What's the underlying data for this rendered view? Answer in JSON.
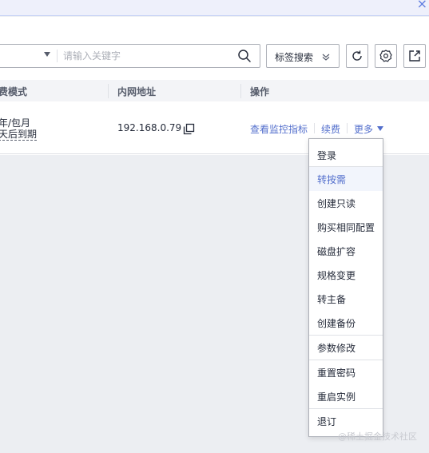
{
  "banner": {
    "close_glyph": "×"
  },
  "toolbar": {
    "search_placeholder": "请输入关键字",
    "tag_search_label": "标签搜索",
    "icons": [
      "search-icon",
      "chevron-down-icon",
      "refresh-icon",
      "settings-icon",
      "export-icon"
    ]
  },
  "table": {
    "headers": {
      "billing": "费模式",
      "private_ip": "内网地址",
      "actions": "操作"
    },
    "row": {
      "billing_line1": "年/包月",
      "billing_line2": "天后到期",
      "private_ip": "192.168.0.79",
      "action_monitor": "查看监控指标",
      "action_renew": "续费",
      "action_more": "更多"
    }
  },
  "more_menu": {
    "items": [
      "登录",
      "转按需",
      "创建只读",
      "购买相同配置",
      "磁盘扩容",
      "规格变更",
      "转主备",
      "创建备份",
      "参数修改",
      "重置密码",
      "重启实例",
      "退订"
    ],
    "active_item": "转按需"
  },
  "watermark": "@稀土掘金技术社区",
  "colors": {
    "link": "#526ecc",
    "border": "#adb0b8",
    "header_bg": "#f3f4f7",
    "page_bg": "#eceef2",
    "active_bg": "#f2f5fc"
  }
}
